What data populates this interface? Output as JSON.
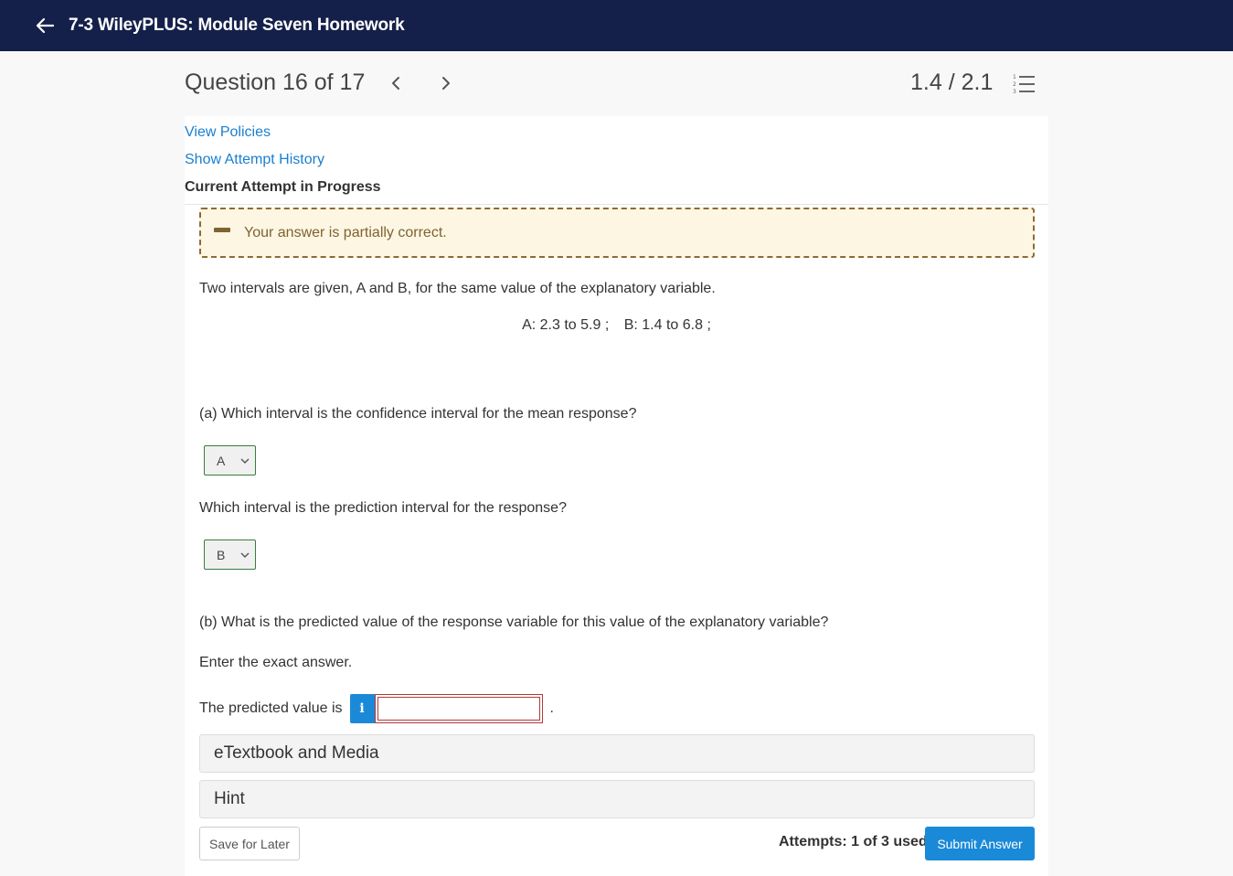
{
  "topbar": {
    "back_icon": "arrow-left-icon",
    "title": "7-3 WileyPLUS: Module Seven Homework"
  },
  "question_header": {
    "question_label": "Question 16 of 17",
    "prev_icon": "chevron-left-icon",
    "next_icon": "chevron-right-icon",
    "score": "1.4 / 2.1",
    "list_icon": "numbered-list-icon"
  },
  "links": {
    "view_policies": "View Policies",
    "show_attempt_history": "Show Attempt History",
    "current_attempt": "Current Attempt in Progress"
  },
  "feedback": {
    "icon": "minus-icon",
    "message": "Your answer is partially correct.",
    "colors": {
      "background": "#fdf6e3",
      "border": "#8c6b34",
      "text": "#7f6330"
    }
  },
  "question": {
    "intro": "Two intervals are given, A and B, for the same value of the explanatory variable.",
    "interval_a": "A: 2.3 to 5.9 ;",
    "interval_b": "B: 1.4 to 6.8 ;",
    "part_a_q1": "(a) Which interval is the confidence interval for the mean response?",
    "part_a_q1_selected": "A",
    "part_a_q2": "Which interval is the prediction interval for the response?",
    "part_a_q2_selected": "B",
    "part_b": "(b) What is the predicted value of the response variable for this value of the explanatory variable?",
    "instruction": "Enter the exact answer.",
    "answer_label": "The predicted value is",
    "answer_value": "",
    "answer_suffix": ".",
    "info_icon": "info-icon",
    "info_glyph": "i"
  },
  "panels": {
    "etextbook": "eTextbook and Media",
    "hint": "Hint"
  },
  "footer": {
    "save_label": "Save for Later",
    "attempts": "Attempts: 1 of 3 used",
    "submit_label": "Submit Answer"
  },
  "colors": {
    "topbar": "#15204a",
    "link": "#1a7fd0",
    "primary": "#1a8ad8",
    "select_border": "#3a7d3a",
    "input_error": "#b23a3a"
  }
}
